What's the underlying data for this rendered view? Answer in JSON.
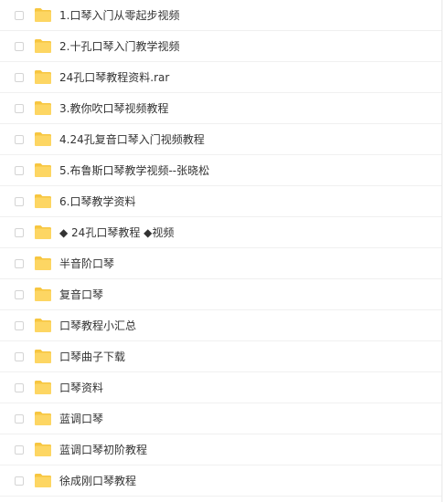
{
  "colors": {
    "folder_body": "#fdd663",
    "folder_tab": "#f7c640",
    "text": "#333333",
    "row_border": "#f0f0f0",
    "checkbox_border": "#d4d4d4"
  },
  "file_list": {
    "items": [
      {
        "name": "1.口琴入门从零起步视频",
        "icon": "folder-icon"
      },
      {
        "name": "2.十孔口琴入门教学视频",
        "icon": "folder-icon"
      },
      {
        "name": "24孔口琴教程资料.rar",
        "icon": "folder-icon"
      },
      {
        "name": "3.教你吹口琴视频教程",
        "icon": "folder-icon"
      },
      {
        "name": "4.24孔复音口琴入门视频教程",
        "icon": "folder-icon"
      },
      {
        "name": "5.布鲁斯口琴教学视频--张晓松",
        "icon": "folder-icon"
      },
      {
        "name": "6.口琴教学资料",
        "icon": "folder-icon"
      },
      {
        "name": "◆ 24孔口琴教程 ◆视频",
        "icon": "folder-icon"
      },
      {
        "name": "半音阶口琴",
        "icon": "folder-icon"
      },
      {
        "name": "复音口琴",
        "icon": "folder-icon"
      },
      {
        "name": "口琴教程小汇总",
        "icon": "folder-icon"
      },
      {
        "name": "口琴曲子下载",
        "icon": "folder-icon"
      },
      {
        "name": "口琴资料",
        "icon": "folder-icon"
      },
      {
        "name": "蓝调口琴",
        "icon": "folder-icon"
      },
      {
        "name": "蓝调口琴初阶教程",
        "icon": "folder-icon"
      },
      {
        "name": "徐成刚口琴教程",
        "icon": "folder-icon"
      }
    ]
  }
}
